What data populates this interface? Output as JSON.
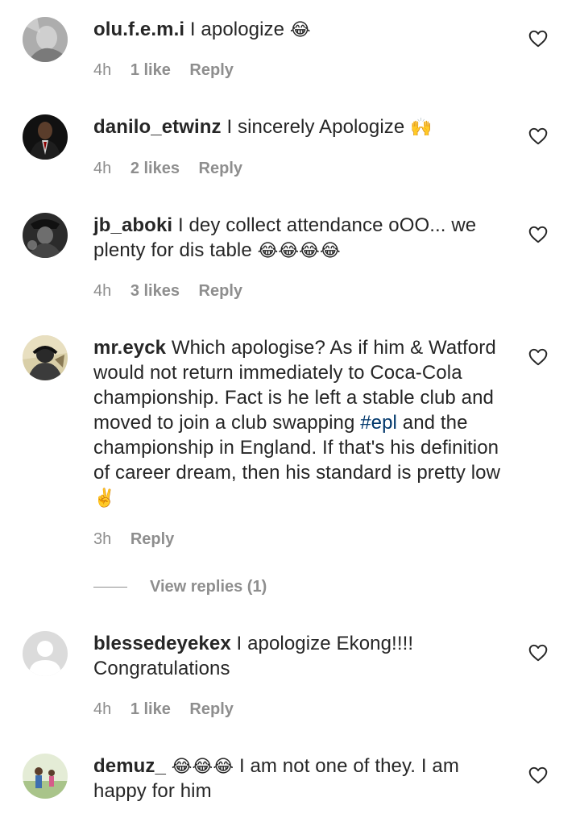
{
  "comments": [
    {
      "username": "olu.f.e.m.i",
      "text": "I apologize",
      "emoji": "😂",
      "time": "4h",
      "likes": "1 like",
      "reply": "Reply",
      "like_icon": "heart-outline-icon"
    },
    {
      "username": "danilo_etwinz",
      "text": "I sincerely Apologize",
      "emoji": "🙌",
      "time": "4h",
      "likes": "2 likes",
      "reply": "Reply",
      "like_icon": "heart-outline-icon"
    },
    {
      "username": "jb_aboki",
      "text": "I dey collect attendance oOO... we plenty for dis table",
      "emoji": "😂😂😂😂",
      "time": "4h",
      "likes": "3 likes",
      "reply": "Reply",
      "like_icon": "heart-outline-icon"
    },
    {
      "username": "mr.eyck",
      "text_before_hashtag": "Which apologise? As if him & Watford would not return immediately to Coca-Cola championship. Fact is he left a stable club and moved to join a club swapping",
      "hashtag": "#epl",
      "text_after_hashtag": "and the championship in England. If that's his definition of career dream, then his standard is pretty low",
      "emoji": "✌️",
      "time": "3h",
      "reply": "Reply",
      "view_replies": "View replies (1)",
      "like_icon": "heart-outline-icon"
    },
    {
      "username": "blessedeyekex",
      "text": "I apologize Ekong!!!! Congratulations",
      "time": "4h",
      "likes": "1 like",
      "reply": "Reply",
      "like_icon": "heart-outline-icon"
    },
    {
      "username": "demuz_",
      "emoji": "😂😂😂",
      "text": "I am not one of they. I am happy for him",
      "like_icon": "heart-outline-icon"
    }
  ],
  "colors": {
    "text": "#262626",
    "meta": "#8e8e8e",
    "hashtag": "#00376b",
    "background": "#ffffff"
  }
}
